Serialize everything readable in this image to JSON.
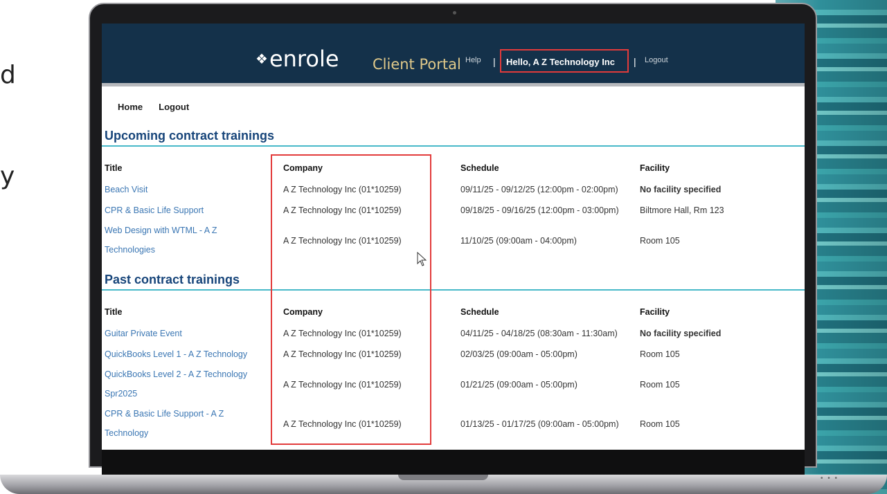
{
  "side_text": [
    "d",
    "y"
  ],
  "header": {
    "brand": "enrole",
    "portal": "Client Portal",
    "help": "Help",
    "separator": "|",
    "greeting": "Hello,  A Z Technology Inc",
    "logout": "Logout"
  },
  "nav": {
    "home": "Home",
    "logout": "Logout"
  },
  "upcoming": {
    "title": "Upcoming contract trainings",
    "headers": {
      "title": "Title",
      "company": "Company",
      "schedule": "Schedule",
      "facility": "Facility"
    },
    "rows": [
      {
        "title": "Beach Visit",
        "company": "A Z Technology Inc (01*10259)",
        "schedule": "09/11/25 - 09/12/25 (12:00pm - 02:00pm)",
        "facility": "No facility specified"
      },
      {
        "title": "CPR & Basic Life Support",
        "company": "A Z Technology Inc (01*10259)",
        "schedule": "09/18/25 - 09/16/25 (12:00pm - 03:00pm)",
        "facility": "Biltmore Hall, Rm 123"
      },
      {
        "title": "Web Design with WTML - A Z Technologies",
        "company": "A Z Technology Inc (01*10259)",
        "schedule": "11/10/25 (09:00am - 04:00pm)",
        "facility": "Room 105"
      }
    ]
  },
  "past": {
    "title": "Past contract trainings",
    "headers": {
      "title": "Title",
      "company": "Company",
      "schedule": "Schedule",
      "facility": "Facility"
    },
    "rows": [
      {
        "title": "Guitar Private Event",
        "company": "A Z Technology Inc (01*10259)",
        "schedule": "04/11/25 - 04/18/25 (08:30am - 11:30am)",
        "facility": "No facility specified"
      },
      {
        "title": "QuickBooks Level 1 - A Z Technology",
        "company": "A Z Technology Inc (01*10259)",
        "schedule": "02/03/25 (09:00am - 05:00pm)",
        "facility": "Room 105"
      },
      {
        "title": "QuickBooks Level 2 - A Z Technology Spr2025",
        "company": "A Z Technology Inc (01*10259)",
        "schedule": "01/21/25 (09:00am - 05:00pm)",
        "facility": "Room 105"
      },
      {
        "title": "CPR & Basic Life Support - A Z Technology",
        "company": "A Z Technology Inc (01*10259)",
        "schedule": "01/13/25 - 01/17/25 (09:00am - 05:00pm)",
        "facility": "Room 105"
      }
    ]
  },
  "colors": {
    "header_bg": "#14314a",
    "accent_rule": "#47b9c9",
    "section_title": "#17457a",
    "link": "#3a76b3",
    "highlight": "#e23b3b"
  }
}
